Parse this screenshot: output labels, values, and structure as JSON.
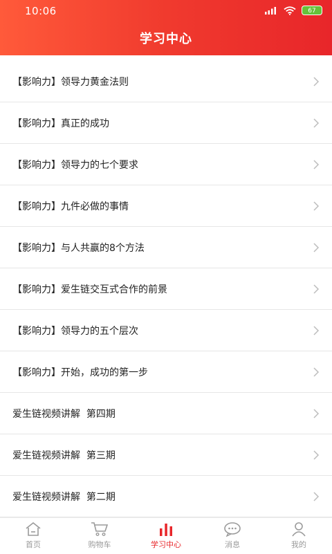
{
  "status": {
    "time": "10:06",
    "battery": "67"
  },
  "header": {
    "title": "学习中心"
  },
  "items": [
    {
      "label": "【影响力】领导力黄金法则"
    },
    {
      "label": "【影响力】真正的成功"
    },
    {
      "label": "【影响力】领导力的七个要求"
    },
    {
      "label": "【影响力】九件必做的事情"
    },
    {
      "label": "【影响力】与人共赢的8个方法"
    },
    {
      "label": "【影响力】爱生链交互式合作的前景"
    },
    {
      "label": "【影响力】领导力的五个层次"
    },
    {
      "label": "【影响力】开始，成功的第一步"
    },
    {
      "label": "爱生链视频讲解  第四期"
    },
    {
      "label": "爱生链视频讲解  第三期"
    },
    {
      "label": "爱生链视频讲解  第二期"
    }
  ],
  "tabbar": {
    "home": "首页",
    "cart": "购物车",
    "learning": "学习中心",
    "messages": "消息",
    "mine": "我的"
  },
  "colors": {
    "accent": "#e8262a",
    "inactive": "#9a9a9a"
  }
}
